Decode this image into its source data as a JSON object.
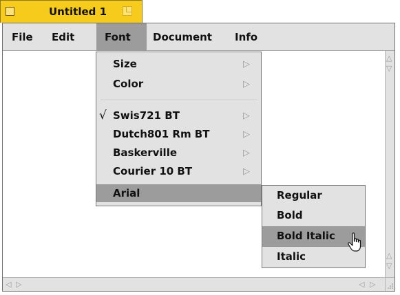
{
  "window": {
    "title": "Untitled 1"
  },
  "menubar": {
    "items": [
      {
        "label": "File"
      },
      {
        "label": "Edit"
      },
      {
        "label": "Font"
      },
      {
        "label": "Document"
      },
      {
        "label": "Info"
      }
    ]
  },
  "font_menu": {
    "size": "Size",
    "color": "Color",
    "fonts": [
      {
        "label": "Swis721 BT",
        "checked": true
      },
      {
        "label": "Dutch801 Rm BT",
        "checked": false
      },
      {
        "label": "Baskerville",
        "checked": false
      },
      {
        "label": "Courier 10 BT",
        "checked": false
      },
      {
        "label": "Arial",
        "checked": false,
        "highlighted": true
      }
    ],
    "submenu_glyph": "▷",
    "check_glyph": "√"
  },
  "style_menu": {
    "items": [
      "Regular",
      "Bold",
      "Bold Italic",
      "Italic"
    ],
    "highlighted": "Bold Italic"
  },
  "colors": {
    "tab": "#f7cb1b",
    "menu_bg": "#e2e2e2",
    "highlight": "#9c9c9c"
  },
  "icons": {
    "zoom": "zoom-box-icon",
    "cursor": "hand-pointer-icon"
  }
}
